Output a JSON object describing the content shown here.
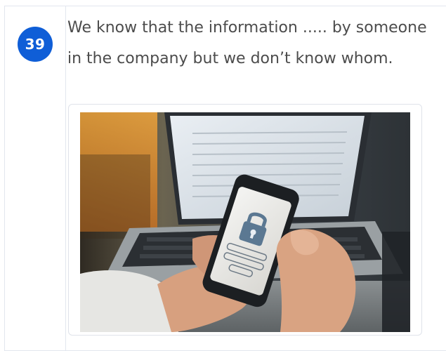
{
  "question": {
    "number": "39",
    "text": "We know that the information ..... by someone in the company but we don’t know whom."
  },
  "image": {
    "description_icon": "phone-lock-photo"
  },
  "colors": {
    "badge": "#0f5ed7",
    "question_text": "#4c4c4c",
    "border": "#e2e6ee"
  }
}
